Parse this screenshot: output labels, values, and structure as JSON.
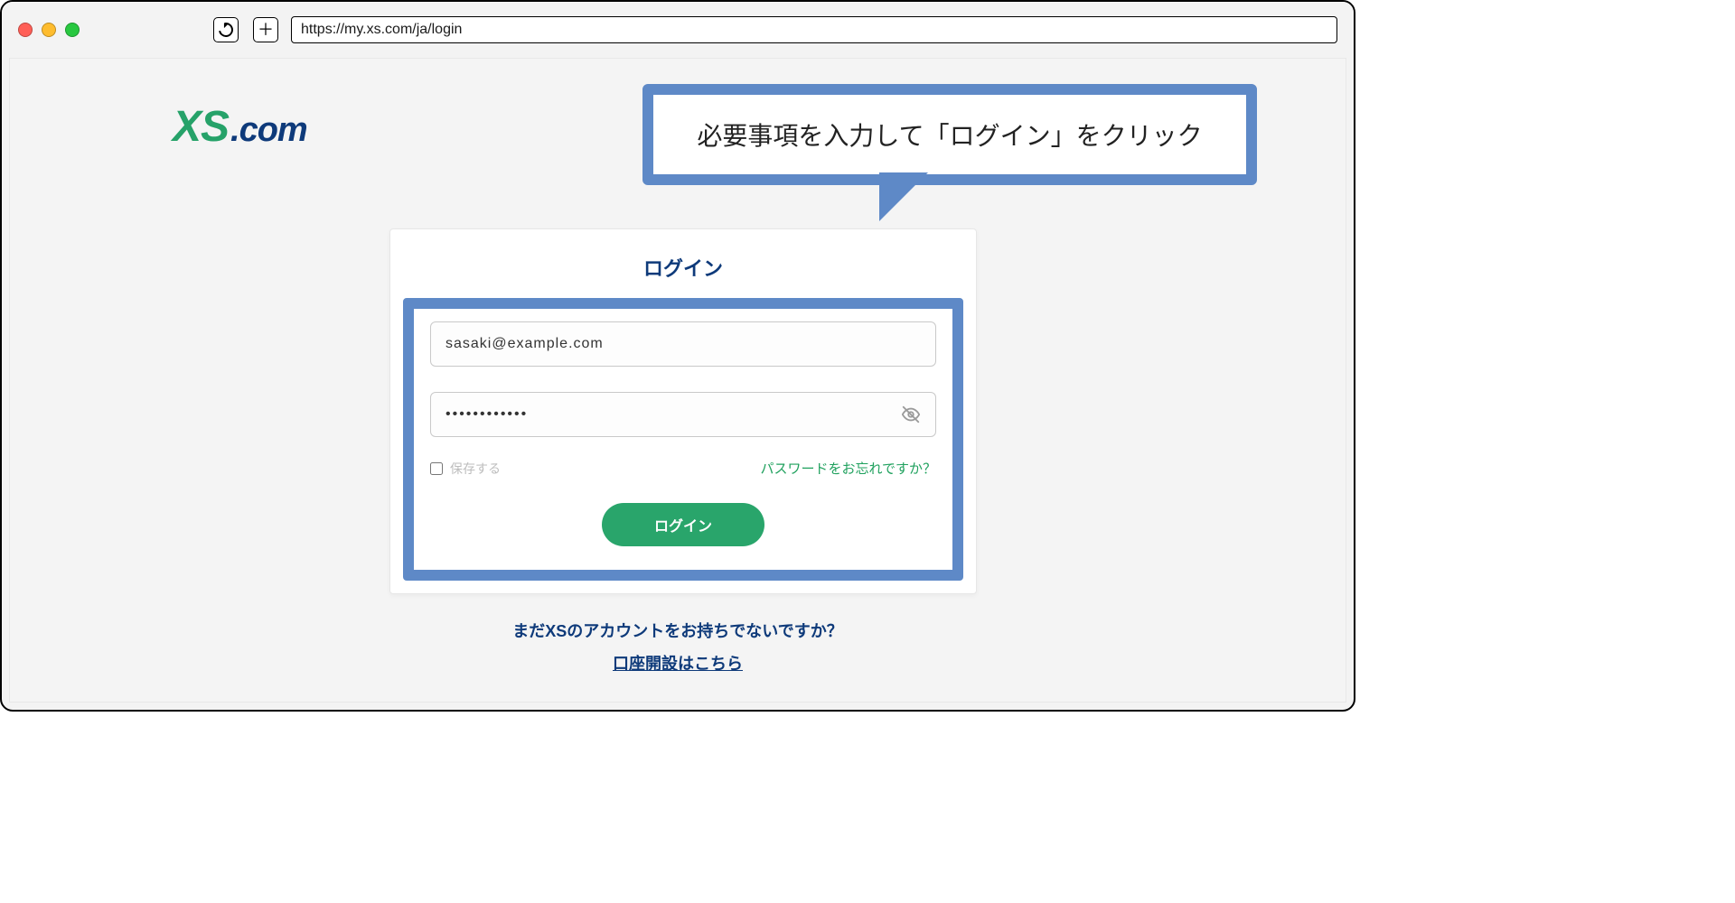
{
  "browser": {
    "url": "https://my.xs.com/ja/login"
  },
  "logo": {
    "xs": "XS",
    "dotcom": ".com"
  },
  "callout": {
    "text": "必要事項を入力して「ログイン」をクリック"
  },
  "login": {
    "title": "ログイン",
    "email_value": "sasaki@example.com",
    "password_value": "••••••••••••",
    "remember_label": "保存する",
    "forgot_label": "パスワードをお忘れですか？",
    "submit_label": "ログイン"
  },
  "below": {
    "question": "まだXSのアカウントをお持ちでないですか？",
    "cta": "口座開設はこちら"
  },
  "colors": {
    "brand_green": "#29a56b",
    "brand_navy": "#0e3a7a",
    "callout_blue": "#5e89c7"
  }
}
